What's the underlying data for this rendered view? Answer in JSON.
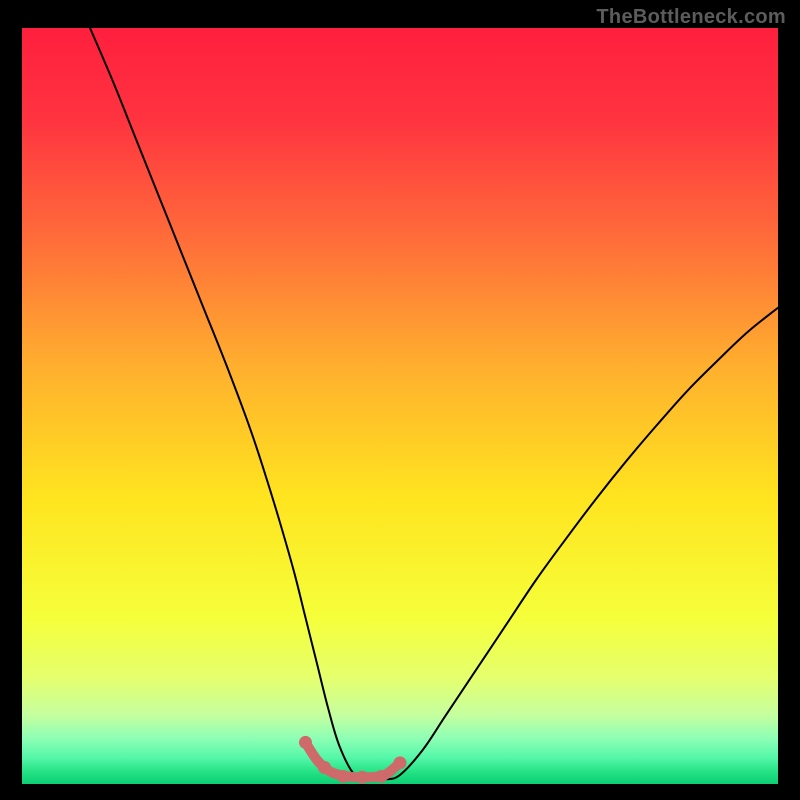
{
  "watermark": "TheBottleneck.com",
  "chart_data": {
    "type": "line",
    "title": "",
    "xlabel": "",
    "ylabel": "",
    "xlim": [
      0,
      100
    ],
    "ylim": [
      0,
      100
    ],
    "grid": false,
    "background_gradient": {
      "stops": [
        {
          "offset": 0.0,
          "color": "#ff1f3e"
        },
        {
          "offset": 0.12,
          "color": "#ff3340"
        },
        {
          "offset": 0.28,
          "color": "#ff6d3a"
        },
        {
          "offset": 0.45,
          "color": "#ffb02e"
        },
        {
          "offset": 0.62,
          "color": "#ffe41f"
        },
        {
          "offset": 0.78,
          "color": "#f5ff3a"
        },
        {
          "offset": 0.86,
          "color": "#e5ff6e"
        },
        {
          "offset": 0.91,
          "color": "#c4ffa0"
        },
        {
          "offset": 0.94,
          "color": "#8cffb5"
        },
        {
          "offset": 0.965,
          "color": "#55f7a9"
        },
        {
          "offset": 0.985,
          "color": "#22e183"
        },
        {
          "offset": 1.0,
          "color": "#0ccf74"
        }
      ]
    },
    "series": [
      {
        "name": "bottleneck-curve",
        "color": "#000000",
        "x": [
          9,
          12,
          15,
          18,
          21,
          24,
          27,
          30,
          32,
          34,
          36,
          37.5,
          39,
          40.5,
          42,
          44,
          46,
          48,
          50,
          53,
          56,
          60,
          64,
          68,
          72,
          76,
          80,
          84,
          88,
          92,
          96,
          100
        ],
        "y": [
          100,
          93,
          85.5,
          78,
          70.5,
          63,
          55.5,
          47.5,
          41.5,
          35,
          28,
          22,
          16,
          10,
          5,
          1.2,
          0.6,
          0.6,
          1.2,
          4.5,
          9,
          15,
          21,
          27,
          32.5,
          37.8,
          42.8,
          47.5,
          52,
          56,
          59.8,
          63
        ]
      },
      {
        "name": "optimal-zone",
        "color": "#cf6a6a",
        "x": [
          37.5,
          39,
          40.5,
          42,
          44,
          46,
          48,
          50
        ],
        "y": [
          5.5,
          3.2,
          1.8,
          1.2,
          0.9,
          0.9,
          1.2,
          2.8
        ]
      }
    ],
    "markers": [
      {
        "series": "optimal-zone",
        "x": 37.5,
        "y": 5.5
      },
      {
        "series": "optimal-zone",
        "x": 40.0,
        "y": 2.2
      },
      {
        "series": "optimal-zone",
        "x": 42.5,
        "y": 1.0
      },
      {
        "series": "optimal-zone",
        "x": 45.0,
        "y": 0.9
      },
      {
        "series": "optimal-zone",
        "x": 47.5,
        "y": 1.0
      },
      {
        "series": "optimal-zone",
        "x": 50.0,
        "y": 2.8
      }
    ]
  }
}
